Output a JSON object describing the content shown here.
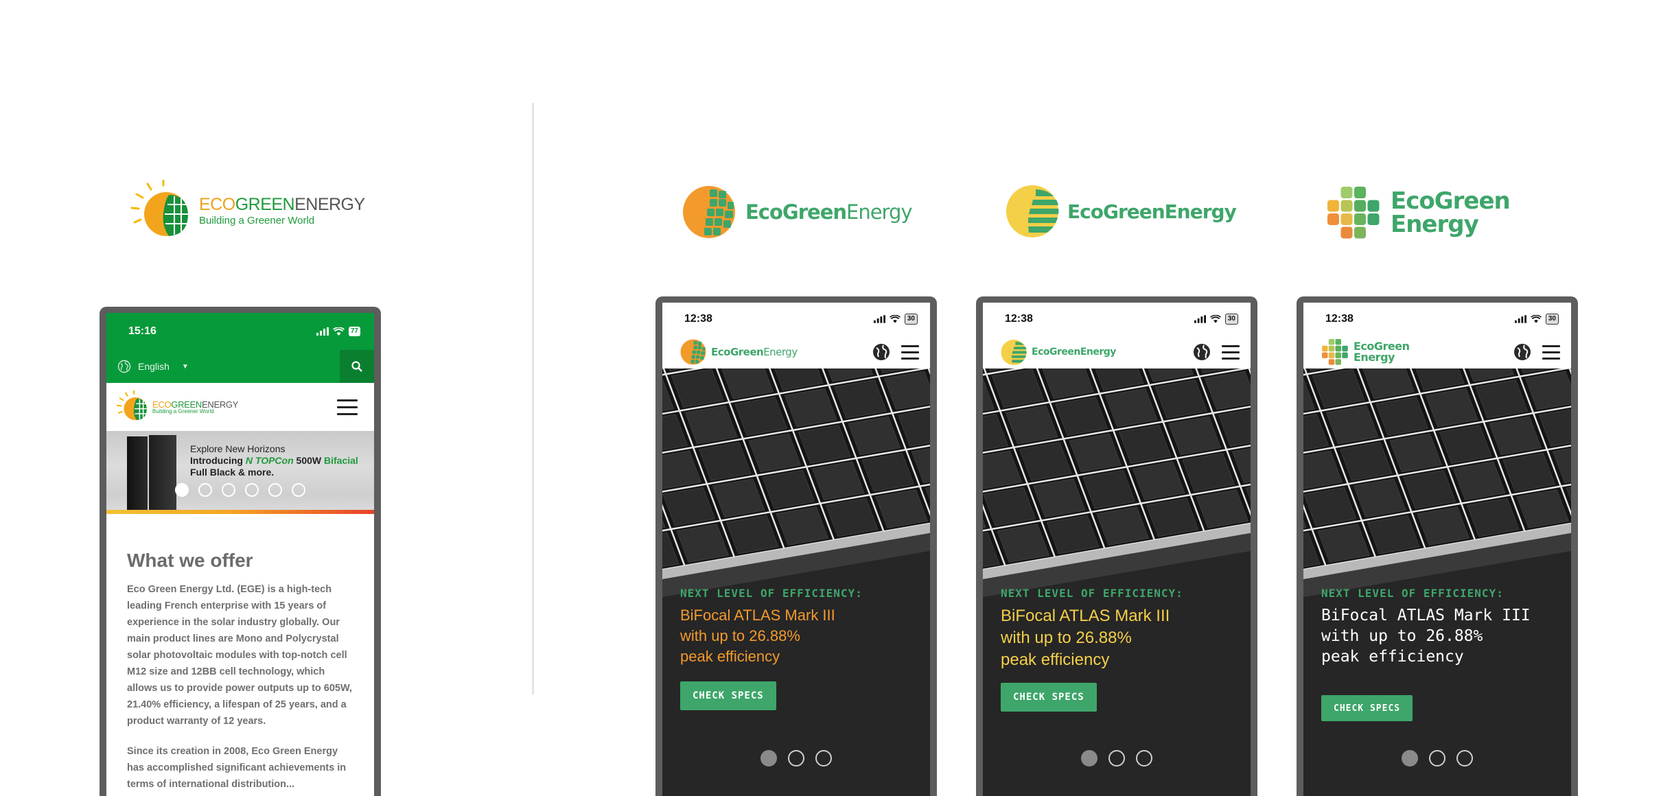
{
  "left_column": {
    "logo": {
      "name_eco": "ECO",
      "name_green": "GREEN",
      "name_energy": "ENERGY",
      "tagline": "Building a Greener World"
    },
    "phone": {
      "status_time": "15:16",
      "battery": "77",
      "language": "English",
      "header_logo": {
        "name_eco": "ECO",
        "name_green": "GREEN",
        "name_energy": "ENERGY",
        "tagline": "Building a Greener World"
      },
      "banner": {
        "line1": "Explore New Horizons",
        "line2_prefix": "Introducing ",
        "line2_ntopcon": "N TOPCon",
        "line2_middle": " 500W ",
        "line2_bifacial": "Bifacial",
        "line3": "Full Black & more."
      },
      "carousel": {
        "count": 6,
        "active": 0
      },
      "section_title": "What we offer",
      "paragraph1": "Eco Green Energy Ltd. (EGE) is a high-tech leading French enterprise with 15 years of experience in the solar industry globally. Our main product lines are  Mono and Polycrystal solar photovoltaic modules with top-notch cell M12 size and 12BB cell technology, which allows us to provide power outputs up to 605W, 21.40% efficiency, a lifespan of 25 years, and a product warranty of 12 years.",
      "paragraph2": "Since its creation in 2008, Eco Green Energy has accomplished significant achievements in terms of international distribution..."
    }
  },
  "variants": [
    {
      "logo_bold": "EcoGreen",
      "logo_light": "Energy",
      "status_time": "12:38",
      "battery": "30",
      "eyebrow": "NEXT LEVEL OF EFFICIENCY:",
      "title_line1": "BiFocal ATLAS Mark III",
      "title_line2": "with up to 26.88%",
      "title_line3": "peak efficiency",
      "cta": "CHECK SPECS",
      "accent_color": "#f39a2c"
    },
    {
      "logo_bold": "EcoGreenEnergy",
      "logo_light": "",
      "status_time": "12:38",
      "battery": "30",
      "eyebrow": "NEXT LEVEL OF EFFICIENCY:",
      "title_line1": "BiFocal ATLAS Mark III",
      "title_line2": "with up to 26.88%",
      "title_line3": "peak efficiency",
      "cta": "CHECK SPECS",
      "accent_color": "#f4cf48"
    },
    {
      "logo_line1": "EcoGreen",
      "logo_line2": "Energy",
      "status_time": "12:38",
      "battery": "30",
      "eyebrow": "NEXT LEVEL OF EFFICIENCY:",
      "title_line1": "BiFocal ATLAS Mark III",
      "title_line2": "with up to 26.88%",
      "title_line3": "peak efficiency",
      "cta": "CHECK SPECS",
      "accent_color": "#ffffff"
    }
  ],
  "carousel_right": {
    "count": 3,
    "active": 0
  },
  "colors": {
    "brand_green": "#079a3a",
    "new_green": "#3ea66a",
    "orange": "#f39a2c",
    "yellow": "#f4cf48",
    "hero_bg": "#262626"
  },
  "icons": [
    "globe-icon",
    "search-icon",
    "hamburger-icon",
    "signal-icon",
    "wifi-icon",
    "battery-icon"
  ]
}
